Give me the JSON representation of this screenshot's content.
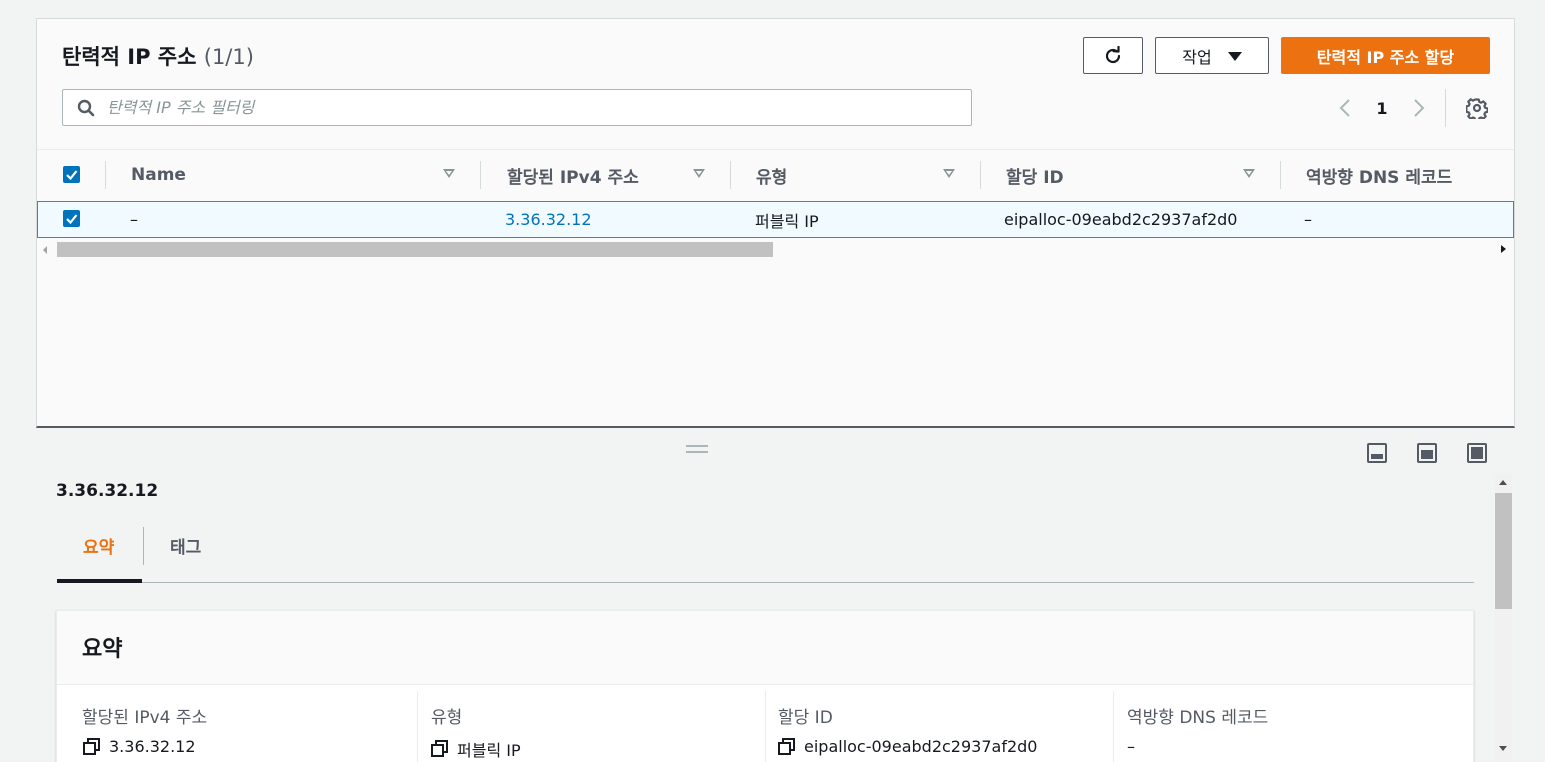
{
  "table_panel": {
    "title": "탄력적 IP 주소",
    "count": "(1/1)",
    "actions_label": "작업",
    "allocate_label": "탄력적 IP 주소 할당",
    "search_placeholder": "탄력적 IP 주소 필터링",
    "page_number": "1",
    "columns": [
      "Name",
      "할당된 IPv4 주소",
      "유형",
      "할당 ID",
      "역방향 DNS 레코드"
    ],
    "rows": [
      {
        "selected": true,
        "name": "–",
        "ipv4": "3.36.32.12",
        "type": "퍼블릭 IP",
        "allocation_id": "eipalloc-09eabd2c2937af2d0",
        "reverse_dns": "–"
      }
    ]
  },
  "detail": {
    "title": "3.36.32.12",
    "tabs": [
      "요약",
      "태그"
    ],
    "active_tab": "요약",
    "summary": {
      "heading": "요약",
      "fields": [
        {
          "label": "할당된 IPv4 주소",
          "value": "3.36.32.12",
          "copy": true
        },
        {
          "label": "유형",
          "value": "퍼블릭 IP",
          "copy": true
        },
        {
          "label": "할당 ID",
          "value": "eipalloc-09eabd2c2937af2d0",
          "copy": true
        },
        {
          "label": "역방향 DNS 레코드",
          "value": "–",
          "copy": false
        }
      ]
    }
  },
  "colors": {
    "primary": "#ec7211",
    "link": "#0073bb",
    "selected_row_bg": "#f1faff",
    "selected_row_border": "#00a1c9"
  }
}
